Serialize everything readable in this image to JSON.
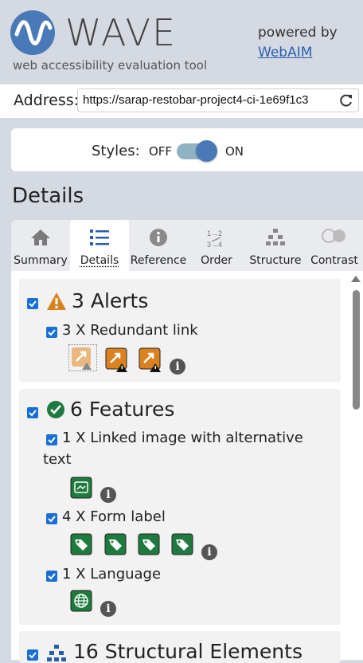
{
  "header": {
    "logo_text": "WAVE",
    "tagline": "web accessibility evaluation tool",
    "powered_by": "powered by",
    "webaim_link": "WebAIM"
  },
  "address": {
    "label": "Address:",
    "value": "https://sarap-restobar-project4-ci-1e69f1c3"
  },
  "styles": {
    "label": "Styles:",
    "off": "OFF",
    "on": "ON",
    "state": "on"
  },
  "section_title": "Details",
  "tabs": [
    {
      "label": "Summary",
      "icon": "home-icon"
    },
    {
      "label": "Details",
      "icon": "list-icon",
      "active": true
    },
    {
      "label": "Reference",
      "icon": "info-icon"
    },
    {
      "label": "Order",
      "icon": "order-icon"
    },
    {
      "label": "Structure",
      "icon": "structure-icon"
    },
    {
      "label": "Contrast",
      "icon": "contrast-icon"
    }
  ],
  "alerts": {
    "title": "3 Alerts",
    "items": [
      {
        "label": "3 X Redundant link",
        "count": 3
      }
    ]
  },
  "features": {
    "title": "6 Features",
    "items": [
      {
        "label": "1 X Linked image with alternative text",
        "line1": "1 X Linked image with alternative",
        "line2": "text",
        "count": 1
      },
      {
        "label": "4 X Form label",
        "count": 4
      },
      {
        "label": "1 X Language",
        "count": 1
      }
    ]
  },
  "structure": {
    "title": "16 Structural Elements"
  },
  "colors": {
    "accent": "#4a79b8",
    "alert_orange": "#d9821e",
    "feature_green": "#1e7a3e",
    "checkbox": "#1a6fd6"
  }
}
